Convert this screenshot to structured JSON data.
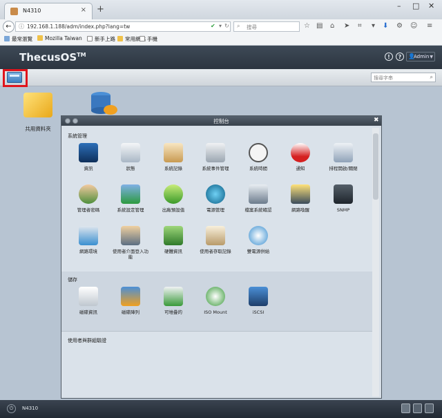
{
  "browser": {
    "tab_title": "N4310",
    "tab_close": "×",
    "new_tab": "+",
    "win_min": "–",
    "win_max": "□",
    "win_close": "✕",
    "url": "192.168.1.188/adm/index.php?lang=tw",
    "search_placeholder": "搜尋",
    "bookmarks": [
      "最常瀏覽",
      "Mozilla Taiwan",
      "新手上路",
      "常用網站",
      "手機"
    ]
  },
  "app": {
    "logo": "ThecusOS",
    "logo_tm": "TM",
    "help1": "!",
    "help2": "?",
    "user": "Admin",
    "keyword_placeholder": "搜尋字串",
    "desktop_label": "共用資料夾",
    "taskbar_label": "N4310"
  },
  "window": {
    "title": "控制台",
    "sections": [
      {
        "label": "系統管理",
        "items": [
          "資訊",
          "狀態",
          "系統記錄",
          "系統事件管理",
          "系統時間",
          "通知",
          "排程開啟/關閉",
          "管理者密碼",
          "系統設定管理",
          "出廠預設值",
          "電源管理",
          "檔案系統確認",
          "網路喚醒",
          "SNMP",
          "網路環境",
          "使用者介面登入功能",
          "硬體資訊",
          "使用者存取記錄",
          "雙電源供給"
        ]
      },
      {
        "label": "儲存",
        "items": [
          "磁碟資訊",
          "磁碟陣列",
          "可堆疊的",
          "ISO Mount",
          "iSCSI"
        ]
      },
      {
        "label": "使用者與群組驗證",
        "items": []
      }
    ]
  },
  "colors": {
    "highlight_border": "#e0141b",
    "header_bg": "#2c3540",
    "desktop_bg": "#b7c4d2"
  }
}
